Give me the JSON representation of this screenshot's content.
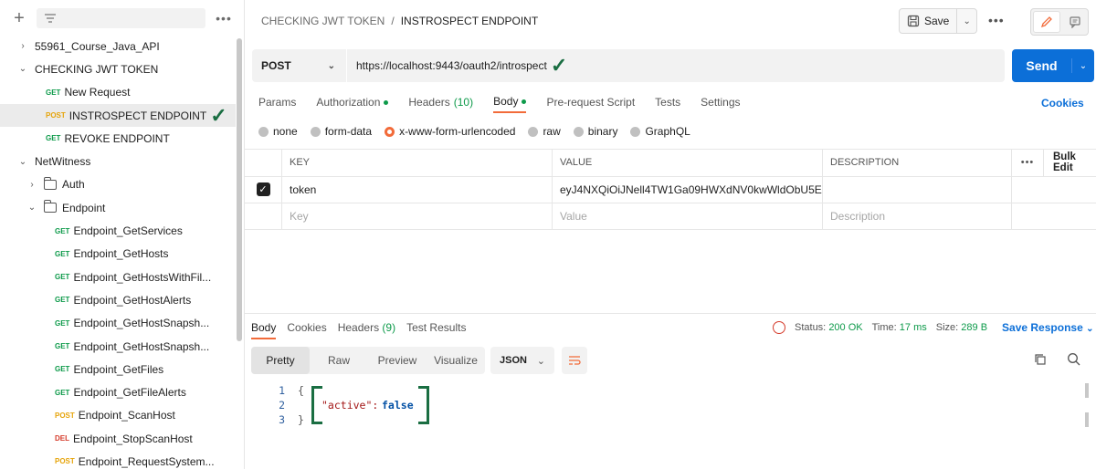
{
  "sidebar": {
    "nodes": [
      {
        "label": "55961_Course_Java_API",
        "kind": "collection",
        "chev": "›"
      },
      {
        "label": "CHECKING JWT TOKEN",
        "kind": "collection",
        "chev": "⌄"
      },
      {
        "label": "New Request",
        "kind": "request",
        "method": "GET"
      },
      {
        "label": "INSTROSPECT ENDPOINT",
        "kind": "request",
        "method": "POST",
        "selected": true
      },
      {
        "label": "REVOKE ENDPOINT",
        "kind": "request",
        "method": "GET"
      },
      {
        "label": "NetWitness",
        "kind": "collection",
        "chev": "⌄"
      },
      {
        "label": "Auth",
        "kind": "folder",
        "chev": "›"
      },
      {
        "label": "Endpoint",
        "kind": "folder",
        "chev": "⌄"
      },
      {
        "label": "Endpoint_GetServices",
        "kind": "request2",
        "method": "GET"
      },
      {
        "label": "Endpoint_GetHosts",
        "kind": "request2",
        "method": "GET"
      },
      {
        "label": "Endpoint_GetHostsWithFil...",
        "kind": "request2",
        "method": "GET"
      },
      {
        "label": "Endpoint_GetHostAlerts",
        "kind": "request2",
        "method": "GET"
      },
      {
        "label": "Endpoint_GetHostSnapsh...",
        "kind": "request2",
        "method": "GET"
      },
      {
        "label": "Endpoint_GetHostSnapsh...",
        "kind": "request2",
        "method": "GET"
      },
      {
        "label": "Endpoint_GetFiles",
        "kind": "request2",
        "method": "GET"
      },
      {
        "label": "Endpoint_GetFileAlerts",
        "kind": "request2",
        "method": "GET"
      },
      {
        "label": "Endpoint_ScanHost",
        "kind": "request2",
        "method": "POST"
      },
      {
        "label": "Endpoint_StopScanHost",
        "kind": "request2",
        "method": "DEL"
      },
      {
        "label": "Endpoint_RequestSystem...",
        "kind": "request2",
        "method": "POST"
      }
    ]
  },
  "header": {
    "breadcrumb_parent": "CHECKING JWT TOKEN",
    "breadcrumb_sep": "/",
    "breadcrumb_current": "INSTROSPECT ENDPOINT",
    "save_label": "Save"
  },
  "request": {
    "method": "POST",
    "url": "https://localhost:9443/oauth2/introspect",
    "send_label": "Send",
    "tabs": [
      "Params",
      "Authorization",
      "Headers",
      "Body",
      "Pre-request Script",
      "Tests",
      "Settings"
    ],
    "headers_count": "(10)",
    "cookies_label": "Cookies",
    "body_types": [
      "none",
      "form-data",
      "x-www-form-urlencoded",
      "raw",
      "binary",
      "GraphQL"
    ]
  },
  "kv_table": {
    "columns": [
      "KEY",
      "VALUE",
      "DESCRIPTION",
      "Bulk Edit"
    ],
    "rows": [
      {
        "key": "token",
        "value": "eyJ4NXQiOiJNell4TW1Ga09HWXdNV0kwWldObU5E...",
        "description": ""
      }
    ],
    "placeholders": {
      "key": "Key",
      "value": "Value",
      "description": "Description"
    }
  },
  "response": {
    "tabs": [
      "Body",
      "Cookies",
      "Headers",
      "Test Results"
    ],
    "headers_count": "(9)",
    "status_label": "Status:",
    "status_value": "200 OK",
    "time_label": "Time:",
    "time_value": "17 ms",
    "size_label": "Size:",
    "size_value": "289 B",
    "save_response": "Save Response",
    "view_modes": [
      "Pretty",
      "Raw",
      "Preview",
      "Visualize"
    ],
    "format": "JSON",
    "lines": [
      "1",
      "2",
      "3"
    ],
    "json_open": "{",
    "json_key": "\"active\":",
    "json_value": "false",
    "json_close": "}"
  },
  "colors": {
    "accent": "#f26b3a",
    "send": "#0c6fd8",
    "get": "#0d9a4a",
    "post": "#e6a40a",
    "delete": "#d53b2b",
    "annotation": "#1a6e42"
  }
}
